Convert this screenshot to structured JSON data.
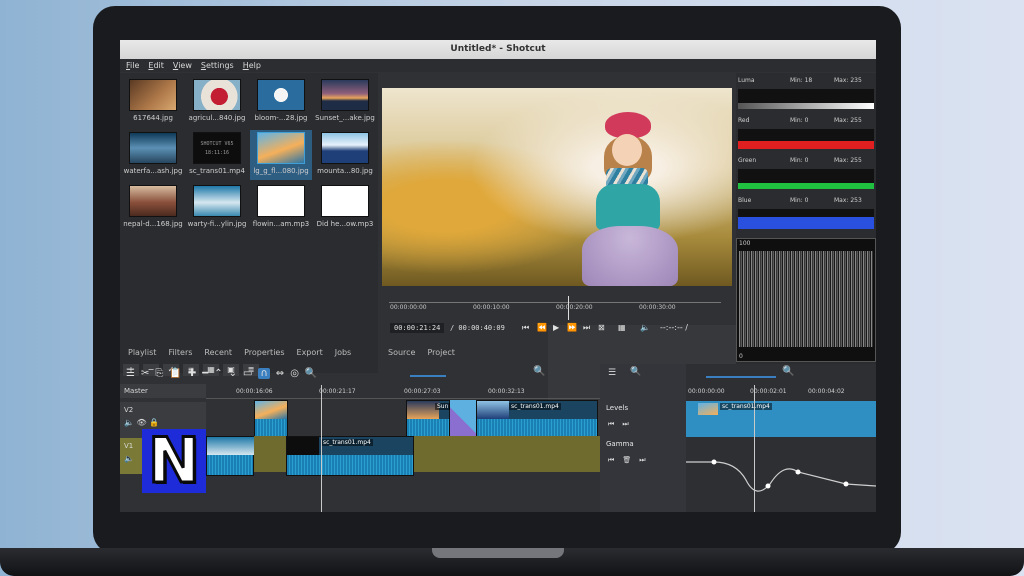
{
  "window": {
    "title": "Untitled* - Shotcut"
  },
  "menu": [
    "File",
    "Edit",
    "View",
    "Settings",
    "Help"
  ],
  "media": [
    {
      "name": "617644.jpg",
      "thumb": "bird"
    },
    {
      "name": "agricul...840.jpg",
      "thumb": "agri"
    },
    {
      "name": "bloom-...28.jpg",
      "thumb": "bloom"
    },
    {
      "name": "Sunset_...ake.jpg",
      "thumb": "sunset"
    },
    {
      "name": "waterfa...ash.jpg",
      "thumb": "water"
    },
    {
      "name": "sc_trans01.mp4",
      "thumb": "trans",
      "overlay": "SHOTCUT V65 18:11:16"
    },
    {
      "name": "lg_g_fl...080.jpg",
      "thumb": "lg",
      "selected": true
    },
    {
      "name": "mounta...80.jpg",
      "thumb": "mount"
    },
    {
      "name": "nepal-d...168.jpg",
      "thumb": "nepal"
    },
    {
      "name": "warty-fi...ylin.jpg",
      "thumb": "warty"
    },
    {
      "name": "flowin...am.mp3",
      "thumb": "white"
    },
    {
      "name": "Did he...ow.mp3",
      "thumb": "white"
    }
  ],
  "media_toolbar": [
    "+",
    "−",
    "✓",
    "≡",
    "▦",
    "▣",
    "≣"
  ],
  "left_tabs": [
    "Playlist",
    "Filters",
    "Recent",
    "Properties",
    "Export",
    "Jobs"
  ],
  "viewer_tabs": [
    "Source",
    "Project"
  ],
  "viewer": {
    "ruler_ticks": [
      "00:00:00:00",
      "00:00:10:00",
      "00:00:20:00",
      "00:00:30:00"
    ],
    "current_time": "00:00:21:24",
    "duration": "/ 00:00:40:09",
    "in_out": "--:--:-- /"
  },
  "scopes": {
    "luma": {
      "label": "Luma",
      "min": "Min: 18",
      "max": "Max: 235"
    },
    "red": {
      "label": "Red",
      "min": "Min: 0",
      "max": "Max: 255",
      "color": "#e02020"
    },
    "green": {
      "label": "Green",
      "min": "Min: 0",
      "max": "Max: 255",
      "color": "#20c040"
    },
    "blue": {
      "label": "Blue",
      "min": "Min: 0",
      "max": "Max: 253",
      "color": "#2a50e0"
    },
    "waveform_top": "100",
    "waveform_bottom": "0"
  },
  "timeline": {
    "ruler_ticks": [
      "00:00:16:06",
      "00:00:21:17",
      "00:00:27:03",
      "00:00:32:13"
    ],
    "tracks": [
      {
        "name": "Master"
      },
      {
        "name": "V2"
      },
      {
        "name": "V1"
      }
    ],
    "clips": {
      "v2_clip": "sc_trans01.mp4",
      "v2_short": "Sun",
      "v1_clip": "sc_trans01.mp4"
    }
  },
  "filters": {
    "levels": "Levels",
    "gamma": "Gamma"
  },
  "keyframes": {
    "ruler_ticks": [
      "00:00:00:00",
      "00:00:02:01",
      "00:00:04:02"
    ],
    "clip": "sc_trans01.mp4"
  },
  "overlay_logo": "N"
}
